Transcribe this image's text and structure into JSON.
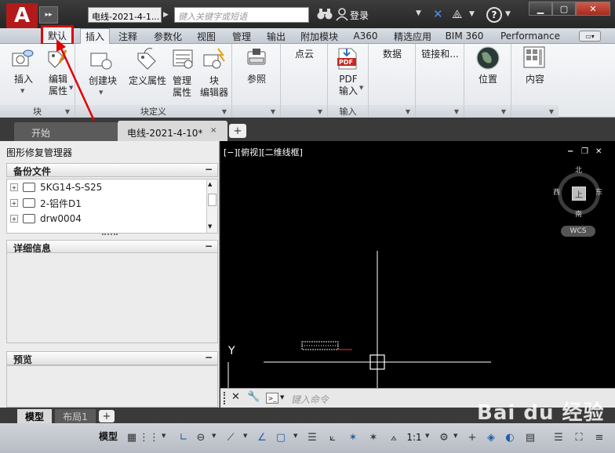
{
  "titlebar": {
    "app_logo": "A",
    "doc_title": "电线-2021-4-1...",
    "search_placeholder": "键入关键字或短语",
    "login_label": "登录"
  },
  "ribbon": {
    "tabs": [
      "默认",
      "插入",
      "注释",
      "参数化",
      "视图",
      "管理",
      "输出",
      "附加模块",
      "A360",
      "精选应用",
      "BIM 360",
      "Performance"
    ],
    "active_tab": "插入",
    "highlighted_tab": "默认",
    "panels": {
      "block": {
        "title": "块",
        "insert": "插入",
        "edit_attr_1": "编辑",
        "edit_attr_2": "属性"
      },
      "block_def": {
        "title": "块定义",
        "create": "创建块",
        "define_attr": "定义属性",
        "manage_attr_1": "管理",
        "manage_attr_2": "属性",
        "block_editor_1": "块",
        "block_editor_2": "编辑器"
      },
      "reference": {
        "label": "参照"
      },
      "pointcloud": {
        "label": "点云"
      },
      "import": {
        "title": "输入",
        "pdf_1": "PDF",
        "pdf_2": "输入",
        "pdf_icon_text": "PDF"
      },
      "data": {
        "label": "数据"
      },
      "linking": {
        "label": "链接和..."
      },
      "location": {
        "label": "位置"
      },
      "content": {
        "label": "内容"
      }
    }
  },
  "file_tabs": {
    "start": "开始",
    "current": "电线-2021-4-10*",
    "close": "×",
    "new": "+"
  },
  "palette": {
    "title": "图形修复管理器",
    "backup_header": "备份文件",
    "backup_items": [
      "5KG14-S-S25",
      "2-铝件D1",
      "drw0004"
    ],
    "detail_header": "详细信息",
    "preview_header": "预览"
  },
  "canvas": {
    "viewport_label": "[−][俯视][二维线框]",
    "compass": {
      "north": "北",
      "south": "南",
      "east": "东",
      "west": "西",
      "center": "上"
    },
    "wcs": "WCS",
    "ucs_y": "Y"
  },
  "command": {
    "placeholder": "键入命令"
  },
  "layout_tabs": {
    "model": "模型",
    "layout1": "布局1",
    "add": "+"
  },
  "status": {
    "model": "模型",
    "scale": "1:1"
  },
  "watermark": "Bai du 经验",
  "colors": {
    "highlight_box": "#e00000",
    "annotation_arrow": "#e00000",
    "canvas_bg": "#000000"
  }
}
